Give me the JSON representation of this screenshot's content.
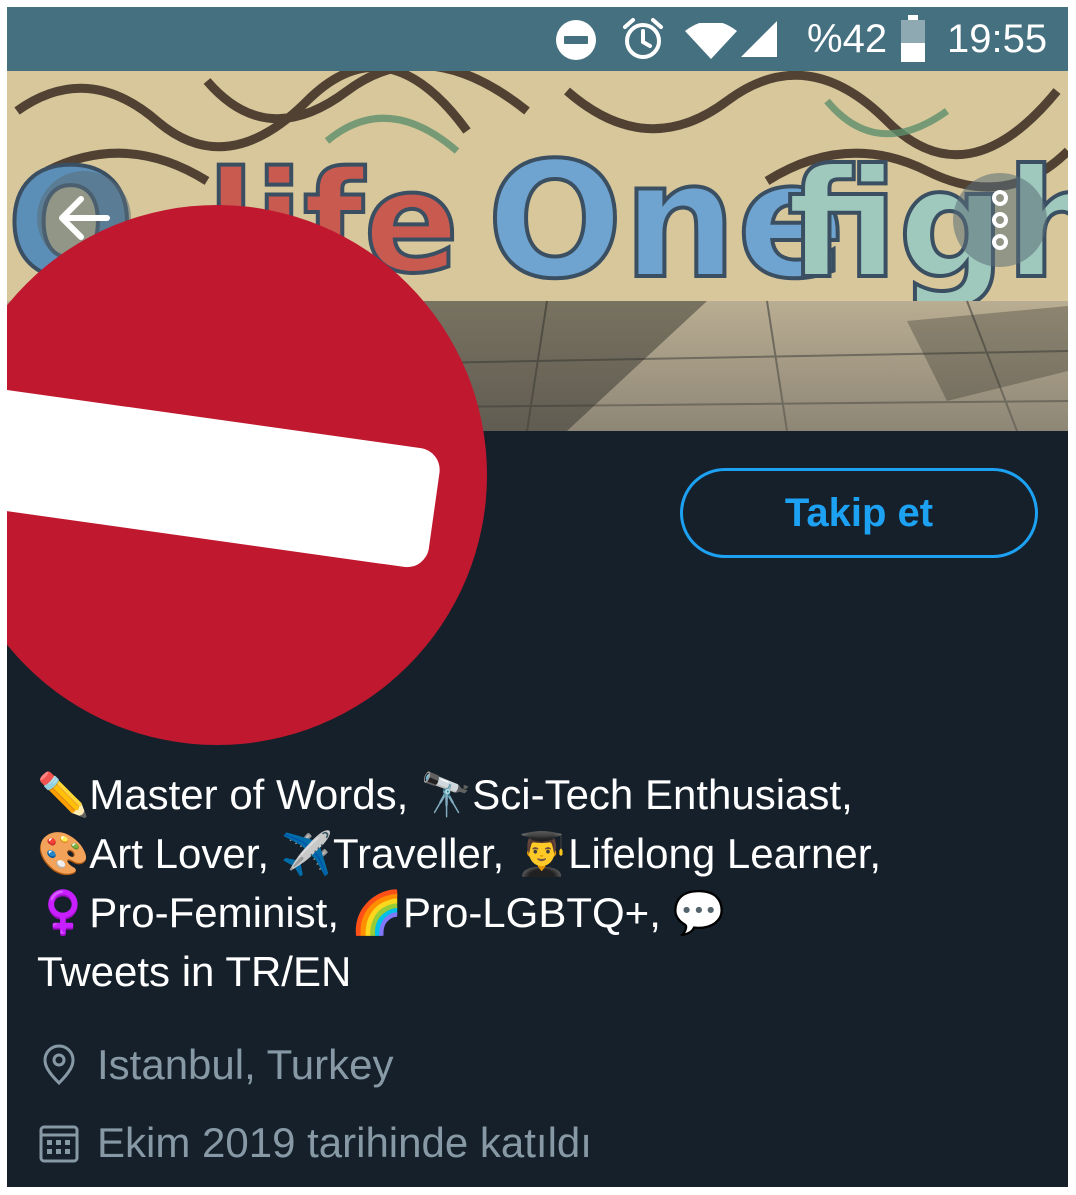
{
  "status_bar": {
    "battery_percent": "%42",
    "time": "19:55",
    "icons": [
      "do-not-disturb-icon",
      "alarm-icon",
      "wifi-icon",
      "cell-signal-icon",
      "battery-icon"
    ]
  },
  "banner": {
    "graffiti_text": "One life One fight",
    "back_icon": "arrow-left-icon",
    "more_icon": "more-vertical-icon"
  },
  "profile": {
    "follow_label": "Takip et",
    "bio_text": "✏️Master of Words, 🔭Sci-Tech Enthusiast,\n🎨Art Lover, ✈️Traveller, 👨‍🎓Lifelong Learner,\n♀️Pro-Feminist, 🌈Pro-LGBTQ+, 💬\nTweets in TR/EN",
    "location": "Istanbul, Turkey",
    "joined": "Ekim 2019 tarihinde katıldı"
  },
  "colors": {
    "background": "#15202b",
    "status_bar": "#45707f",
    "accent": "#1da1f2",
    "muted_text": "#8899a6",
    "censor_red": "#c0182f"
  }
}
